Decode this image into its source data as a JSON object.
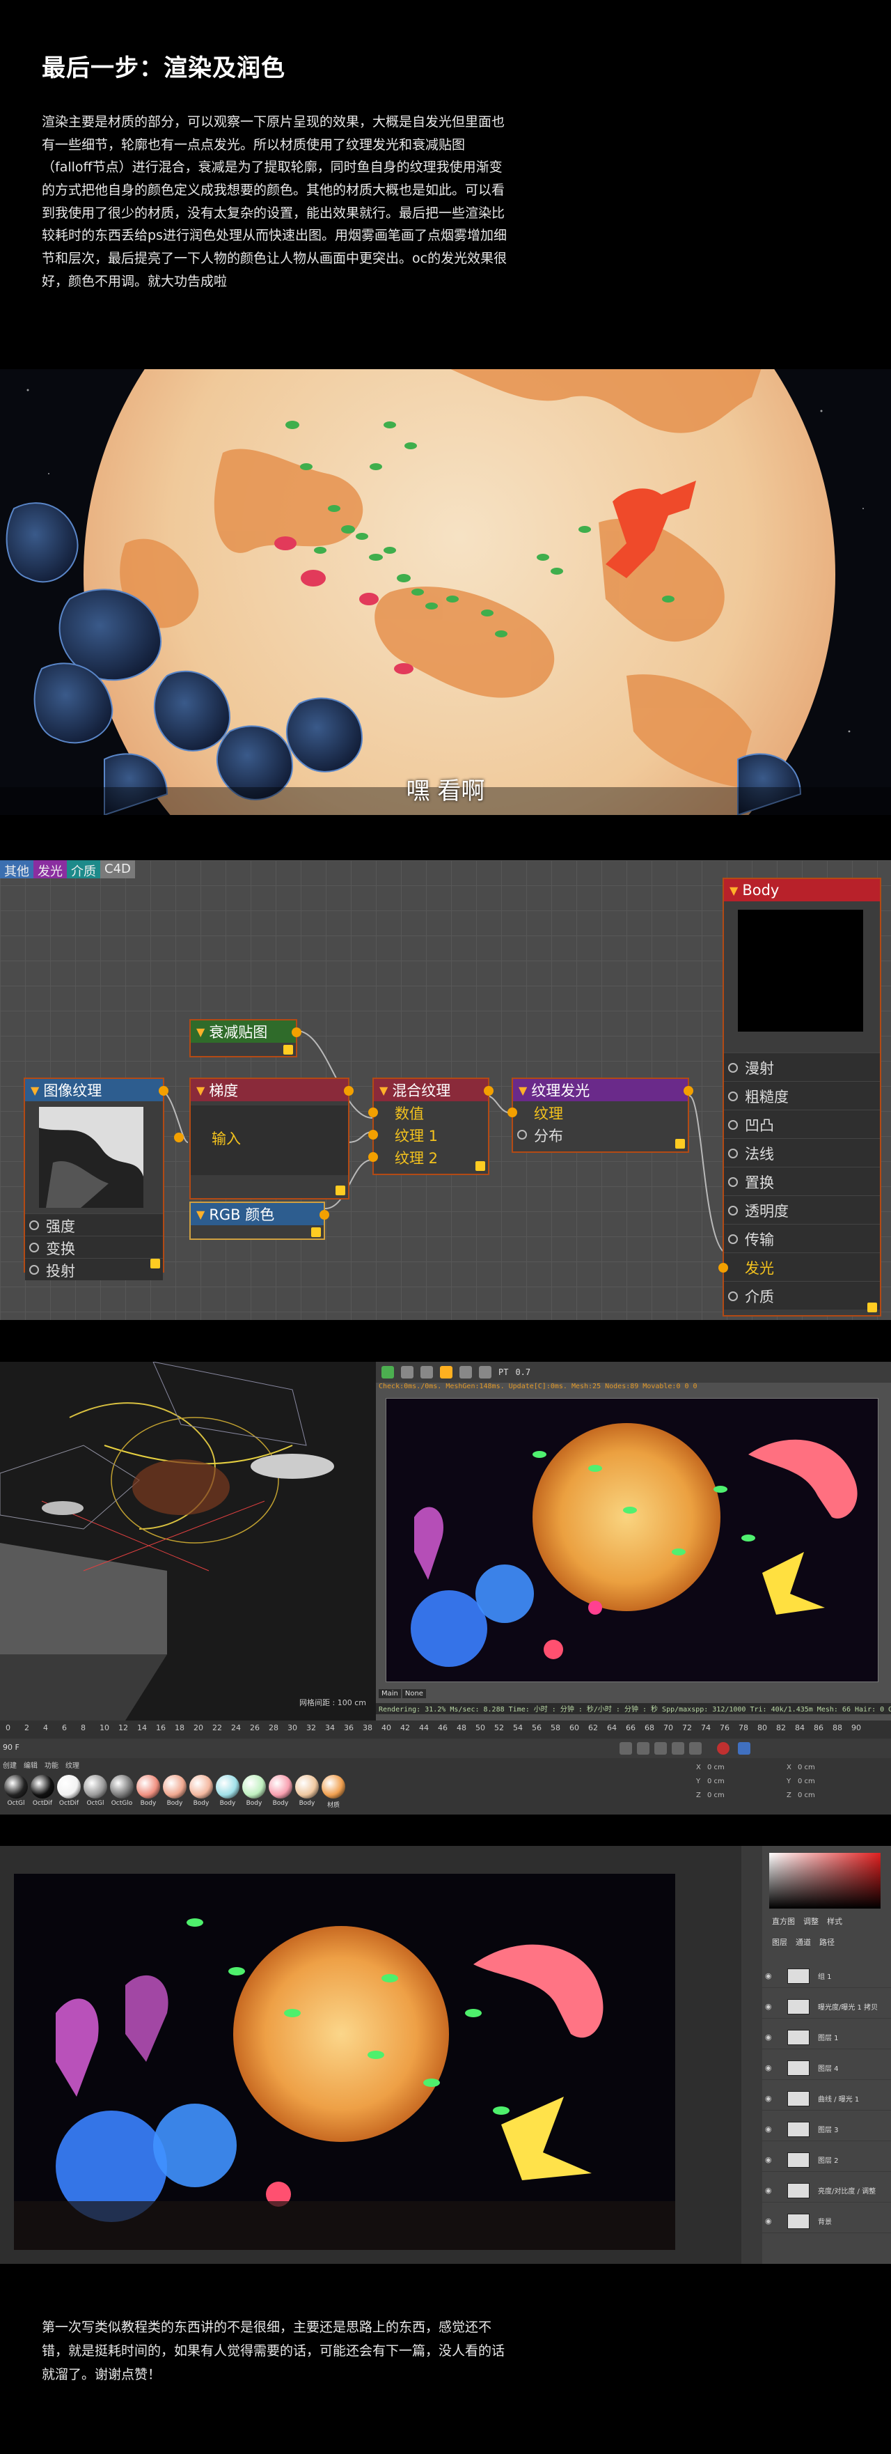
{
  "intro": {
    "title": "最后一步：渲染及润色",
    "body": "渲染主要是材质的部分，可以观察一下原片呈现的效果，大概是自发光但里面也有一些细节，轮廓也有一点点发光。所以材质使用了纹理发光和衰减贴图（falloff节点）进行混合，衰减是为了提取轮廓，同时鱼自身的纹理我使用渐变的方式把他自身的颜色定义成我想要的颜色。其他的材质大概也是如此。可以看到我使用了很少的材质，没有太复杂的设置，能出效果就行。最后把一些渲染比较耗时的东西丢给ps进行润色处理从而快速出图。用烟雾画笔画了点烟雾增加细节和层次，最后提亮了一下人物的颜色让人物从画面中更突出。oc的发光效果很好，颜色不用调。就大功告成啦"
  },
  "scene1": {
    "subtitle": "嘿 看啊"
  },
  "node_editor": {
    "tabs": [
      {
        "label": "其他",
        "color": "#3b6fb0"
      },
      {
        "label": "发光",
        "color": "#8a2ea0"
      },
      {
        "label": "介质",
        "color": "#1d8a8a"
      },
      {
        "label": "C4D",
        "color": "#7a7a7a"
      }
    ],
    "nodes": {
      "image_texture": {
        "title": "图像纹理",
        "header_color": "#2d5d8f",
        "ports": [
          "强度",
          "变换",
          "投射"
        ]
      },
      "falloff": {
        "title": "衰减贴图",
        "header_color": "#2f6b2a"
      },
      "gradient": {
        "title": "梯度",
        "header_color": "#8a2a3a",
        "ports": [
          "输入"
        ]
      },
      "rgb": {
        "title": "RGB 颜色",
        "header_color": "#2d5d8f"
      },
      "mix": {
        "title": "混合纹理",
        "header_color": "#8a2a3a",
        "ports": [
          "数值",
          "纹理 1",
          "纹理 2"
        ]
      },
      "tex_emission": {
        "title": "纹理发光",
        "header_color": "#6a2a8a",
        "ports": [
          "纹理",
          "分布"
        ]
      },
      "body": {
        "title": "Body",
        "header_color": "#b8212a",
        "ports": [
          "漫射",
          "粗糙度",
          "凹凸",
          "法线",
          "置换",
          "透明度",
          "传输",
          "发光",
          "介质"
        ]
      }
    }
  },
  "c4d": {
    "toolbar_label": "PT",
    "toolbar_value": "0.7",
    "status_line": "Check:0ms./0ms. MeshGen:148ms. Update[C]:0ms. Mesh:25 Nodes:89 Movable:0 0 0",
    "render_tabs": [
      "Main",
      "None"
    ],
    "render_stats": "Rendering: 31.2%  Ms/sec: 8.288  Time: 小时 : 分钟 : 秒/小时 : 分钟 : 秒  Spp/maxspp: 312/1000  Tri: 40k/1.435m  Mesh: 66  Hair: 0  GPU: 1",
    "grid_label": "网格间距 : 100 cm",
    "timeline_ticks": [
      "0",
      "2",
      "4",
      "6",
      "8",
      "10",
      "12",
      "14",
      "16",
      "18",
      "20",
      "22",
      "24",
      "26",
      "28",
      "30",
      "32",
      "34",
      "36",
      "38",
      "40",
      "42",
      "44",
      "46",
      "48",
      "50",
      "52",
      "54",
      "56",
      "58",
      "60",
      "62",
      "64",
      "66",
      "68",
      "70",
      "72",
      "74",
      "76",
      "78",
      "80",
      "82",
      "84",
      "86",
      "88",
      "90"
    ],
    "frame_field": "90 F",
    "material_menu": [
      "创建",
      "编辑",
      "功能",
      "纹理"
    ],
    "materials": [
      {
        "label": "OctGl",
        "color": "#222222"
      },
      {
        "label": "OctDif",
        "color": "#111111"
      },
      {
        "label": "OctDif",
        "color": "#f2f2f2"
      },
      {
        "label": "OctGl",
        "color": "#9a9a9a"
      },
      {
        "label": "OctGlo",
        "color": "#7a7a7a"
      },
      {
        "label": "Body",
        "color": "#f09080"
      },
      {
        "label": "Body",
        "color": "#f0a890"
      },
      {
        "label": "Body",
        "color": "#f4b8a0"
      },
      {
        "label": "Body",
        "color": "#a0e0e8"
      },
      {
        "label": "Body",
        "color": "#c0f0c0"
      },
      {
        "label": "Body",
        "color": "#f8a0b0"
      },
      {
        "label": "Body",
        "color": "#f0c8a0"
      },
      {
        "label": "材质",
        "color": "#f0a050"
      }
    ],
    "attr_rows": [
      "X",
      "Y",
      "Z",
      "X",
      "Y",
      "Z"
    ],
    "attr_values": [
      "0 cm",
      "0 cm",
      "0 cm",
      "0 cm",
      "0 cm",
      "0 cm"
    ]
  },
  "ps": {
    "panel_tabs": [
      "直方图",
      "调整",
      "样式"
    ],
    "layer_tabs": [
      "图层",
      "通道",
      "路径"
    ],
    "layers": [
      {
        "name": "组 1"
      },
      {
        "name": "曝光度/曝光 1 拷贝"
      },
      {
        "name": "图层 1"
      },
      {
        "name": "图层 4"
      },
      {
        "name": "曲线 / 曝光 1"
      },
      {
        "name": "图层 3"
      },
      {
        "name": "图层 2"
      },
      {
        "name": "亮度/对比度 / 调整"
      },
      {
        "name": "背景"
      }
    ]
  },
  "outro": {
    "body": "第一次写类似教程类的东西讲的不是很细，主要还是思路上的东西，感觉还不错，就是挺耗时间的，如果有人觉得需要的话，可能还会有下一篇，没人看的话就溜了。谢谢点赞！"
  }
}
